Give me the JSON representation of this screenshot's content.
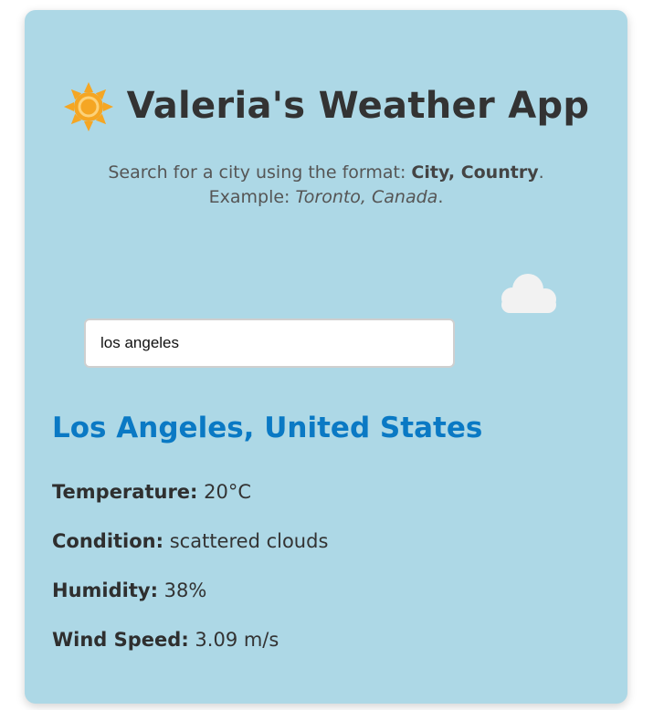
{
  "app": {
    "title": "Valeria's Weather App",
    "icon": "sun-icon"
  },
  "instructions": {
    "line1_prefix": "Search for a city using the format: ",
    "format": "City, Country",
    "line1_suffix": ".",
    "line2_prefix": "Example: ",
    "example": "Toronto, Canada",
    "line2_suffix": "."
  },
  "weather_icon": "cloud-icon",
  "search": {
    "value": "los angeles",
    "placeholder": ""
  },
  "result": {
    "location": "Los Angeles, United States",
    "stats": [
      {
        "label": "Temperature:",
        "value": "20°C"
      },
      {
        "label": "Condition:",
        "value": "scattered clouds"
      },
      {
        "label": "Humidity:",
        "value": "38%"
      },
      {
        "label": "Wind Speed:",
        "value": "3.09 m/s"
      }
    ]
  },
  "colors": {
    "card_background": "#add8e6",
    "city_heading": "#0a79c4",
    "sun": "#f5a623",
    "cloud": "#f2f2f2"
  }
}
